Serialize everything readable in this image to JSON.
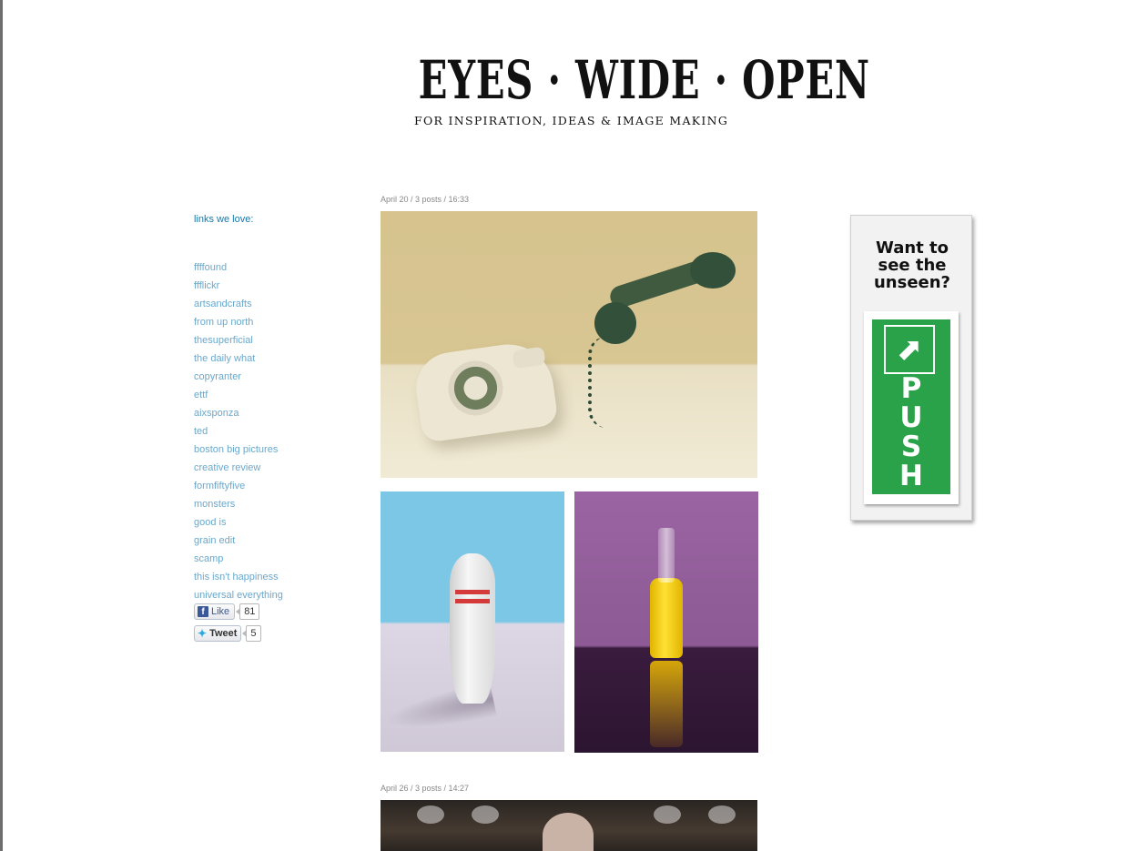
{
  "header": {
    "title": "EYES · WIDE · OPEN",
    "tagline": "FOR INSPIRATION, IDEAS & IMAGE MAKING"
  },
  "sidebar": {
    "heading": "links we love:",
    "links": [
      "ffffound",
      "ffflickr",
      "artsandcrafts",
      "from up north",
      "thesuperficial",
      "the daily what",
      "copyranter",
      "ettf",
      "aixsponza",
      "ted",
      "boston big pictures",
      "creative review",
      "formfiftyfive",
      "monsters",
      "good is",
      "grain edit",
      "scamp",
      "this isn't happiness",
      "universal everything"
    ],
    "like_label": "Like",
    "like_count": "81",
    "tweet_label": "Tweet",
    "tweet_count": "5"
  },
  "posts": [
    {
      "meta": "April 20 / 3 posts / 16:33"
    },
    {
      "meta": "April 26 / 3 posts / 14:27"
    }
  ],
  "ad": {
    "line1": "Want to",
    "line2": "see the",
    "line3": "unseen?",
    "sign_letters": [
      "P",
      "U",
      "S",
      "H"
    ]
  },
  "colors": {
    "link": "#6aa8cc",
    "heading_link": "#1a78a8",
    "sign_green": "#2aa24a"
  },
  "icons": [
    "facebook-icon",
    "twitter-icon",
    "arrow-icon"
  ]
}
